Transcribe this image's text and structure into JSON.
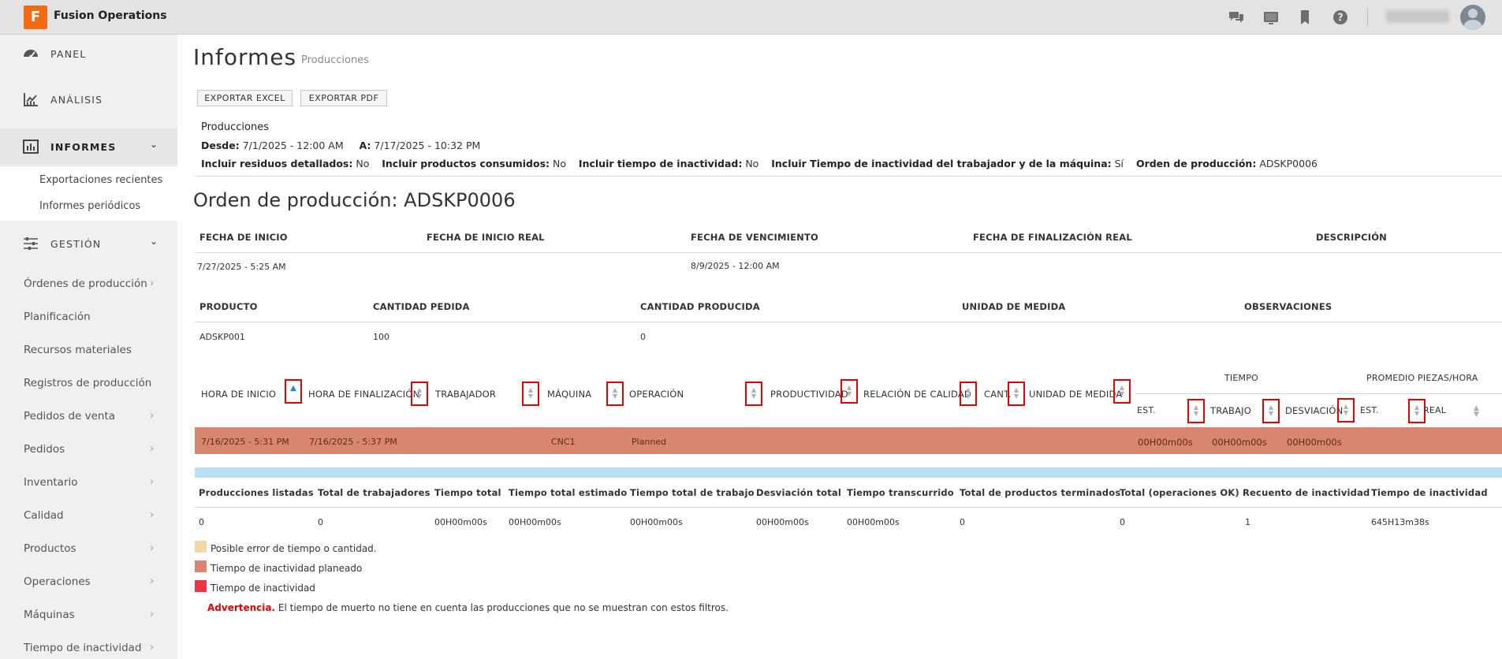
{
  "app": {
    "logo_letter": "F",
    "title": "Fusion Operations"
  },
  "topbar": {
    "icons": [
      "chat-icon",
      "tv-icon",
      "bookmark-icon",
      "help-icon"
    ]
  },
  "sidebar": {
    "main_items": [
      {
        "label": "PANEL",
        "icon": "gauge-icon"
      },
      {
        "label": "ANÁLISIS",
        "icon": "chart-icon"
      },
      {
        "label": "INFORMES",
        "icon": "report-icon"
      },
      {
        "label": "GESTIÓN",
        "icon": "sliders-icon"
      }
    ],
    "informes_sub": [
      "Exportaciones recientes",
      "Informes periódicos"
    ],
    "gestion_items": [
      "Órdenes de producción",
      "Planificación",
      "Recursos materiales",
      "Registros de producción",
      "Pedidos de venta",
      "Pedidos",
      "Inventario",
      "Calidad",
      "Productos",
      "Operaciones",
      "Máquinas",
      "Tiempo de inactividad"
    ]
  },
  "page": {
    "title": "Informes",
    "subtitle": "Producciones",
    "export_excel": "EXPORTAR EXCEL",
    "export_pdf": "EXPORTAR PDF"
  },
  "filters": {
    "title": "Producciones",
    "desde_label": "Desde:",
    "desde": "7/1/2025 - 12:00 AM",
    "a_label": "A:",
    "a": "7/17/2025 - 10:32 PM",
    "residuos_label": "Incluir residuos detallados:",
    "residuos": "No",
    "consumidos_label": "Incluir productos consumidos:",
    "consumidos": "No",
    "inactividad_label": "Incluir tiempo de inactividad:",
    "inactividad": "No",
    "trab_maq_label": "Incluir Tiempo de inactividad del trabajador y de la máquina:",
    "trab_maq": "Sí",
    "orden_label": "Orden de producción:",
    "orden": "ADSKP0006"
  },
  "order": {
    "title": "Orden de producción: ADSKP0006",
    "headers": [
      "FECHA DE INICIO",
      "FECHA DE INICIO REAL",
      "FECHA DE VENCIMIENTO",
      "FECHA DE FINALIZACIÓN REAL",
      "DESCRIPCIÓN"
    ],
    "values": [
      "7/27/2025 - 5:25 AM",
      "",
      "8/9/2025 - 12:00 AM",
      "",
      ""
    ]
  },
  "product": {
    "headers": [
      "PRODUCTO",
      "CANTIDAD PEDIDA",
      "CANTIDAD PRODUCIDA",
      "UNIDAD DE MEDIDA",
      "OBSERVACIONES"
    ],
    "values": [
      "ADSKP001",
      "100",
      "0",
      "",
      ""
    ]
  },
  "detail": {
    "headers": [
      "HORA DE INICIO",
      "HORA DE FINALIZACIÓN",
      "TRABAJADOR",
      "MÁQUINA",
      "OPERACIÓN",
      "PRODUCTIVIDAD",
      "RELACIÓN DE CALIDAD",
      "CANT.",
      "UNIDAD DE MEDIDA"
    ],
    "group_tiempo": "TIEMPO",
    "group_promedio": "PROMEDIO PIEZAS/HORA",
    "sub_tiempo": [
      "EST.",
      "TRABAJO",
      "DESVIACIÓN"
    ],
    "sub_promedio": [
      "EST.",
      "REAL"
    ],
    "row": {
      "inicio": "7/16/2025 - 5:31 PM",
      "fin": "7/16/2025 - 5:37 PM",
      "maquina": "CNC1",
      "operacion": "Planned",
      "est": "00H00m00s",
      "trabajo": "00H00m00s",
      "desviacion": "00H00m00s"
    },
    "row_color": "#d98670"
  },
  "summary": {
    "headers": [
      "Producciones listadas",
      "Total de trabajadores",
      "Tiempo total",
      "Tiempo total estimado",
      "Tiempo total de trabajo",
      "Desviación total",
      "Tiempo transcurrido",
      "Total de productos terminados",
      "Total (operaciones OK)",
      "Recuento de inactividad",
      "Tiempo de inactividad"
    ],
    "values": [
      "0",
      "0",
      "00H00m00s",
      "00H00m00s",
      "00H00m00s",
      "00H00m00s",
      "00H00m00s",
      "0",
      "0",
      "1",
      "645H13m38s"
    ]
  },
  "legend": [
    {
      "label": "Posible error de tiempo o cantidad.",
      "color": "#f2d8a7"
    },
    {
      "label": "Tiempo de inactividad planeado",
      "color": "#d98670"
    },
    {
      "label": "Tiempo de inactividad",
      "color": "#ee3344"
    }
  ],
  "warning": {
    "label": "Advertencia.",
    "text": "El tiempo de muerto no tiene en cuenta las producciones que no se muestran con estos filtros."
  }
}
